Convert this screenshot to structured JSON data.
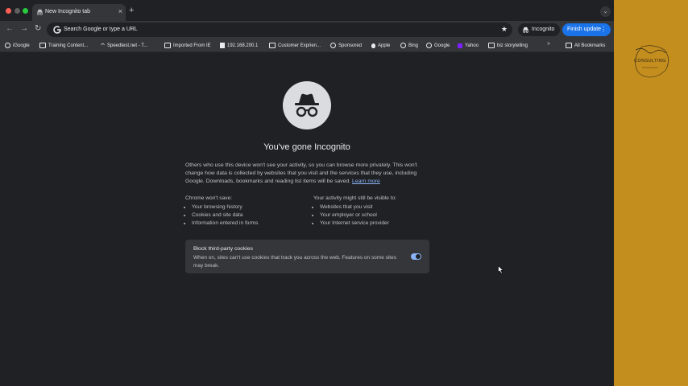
{
  "tab": {
    "title": "New Incognito tab",
    "close": "×",
    "new_tab": "+",
    "search_tabs": "⌄"
  },
  "toolbar": {
    "back": "←",
    "forward": "→",
    "reload": "↻",
    "omnibox_text": "Search Google or type a URL",
    "star": "★",
    "incognito_label": "Incognito",
    "finish_update_label": "Finish update",
    "menu_dots": "⋮"
  },
  "bookmarks": {
    "items": [
      {
        "label": "iGoogle",
        "icon": "google-icon"
      },
      {
        "label": "Training Content...",
        "icon": "folder-icon"
      },
      {
        "label": "Speedtest.net - T...",
        "icon": "speedtest-icon"
      },
      {
        "label": "Imported From IE",
        "icon": "folder-icon"
      },
      {
        "label": "192.168.200.1",
        "icon": "page-icon"
      },
      {
        "label": "Customer Exprien...",
        "icon": "folder-icon"
      },
      {
        "label": "Sponsored",
        "icon": "globe-icon"
      },
      {
        "label": "Apple",
        "icon": "apple-icon"
      },
      {
        "label": "Bing",
        "icon": "globe-icon"
      },
      {
        "label": "Google",
        "icon": "google-icon"
      },
      {
        "label": "Yahoo",
        "icon": "yahoo-icon"
      },
      {
        "label": "biz storytelling",
        "icon": "folder-icon"
      }
    ],
    "more": "»",
    "all_bookmarks": "All Bookmarks"
  },
  "page": {
    "heading": "You've gone Incognito",
    "paragraph": "Others who use this device won't see your activity, so you can browse more privately. This won't change how data is collected by websites that you visit and the services that they use, including Google. Downloads, bookmarks and reading list items will be saved.",
    "learn_more": "Learn more",
    "wont_save": {
      "title": "Chrome won't save:",
      "items": [
        "Your browsing history",
        "Cookies and site data",
        "Information entered in forms"
      ]
    },
    "might_be_visible": {
      "title": "Your activity might still be visible to:",
      "items": [
        "Websites that you visit",
        "Your employer or school",
        "Your Internet service provider"
      ]
    },
    "cookies_card": {
      "title": "Block third-party cookies",
      "description": "When on, sites can't use cookies that track you across the web. Features on some sites may break.",
      "toggle_on": true
    }
  },
  "side_logo": {
    "text": "CONSULTING"
  },
  "colors": {
    "browser_bg": "#202124",
    "toolbar_bg": "#35363a",
    "accent_blue": "#1a73e8",
    "side_panel": "#c48e1e"
  }
}
